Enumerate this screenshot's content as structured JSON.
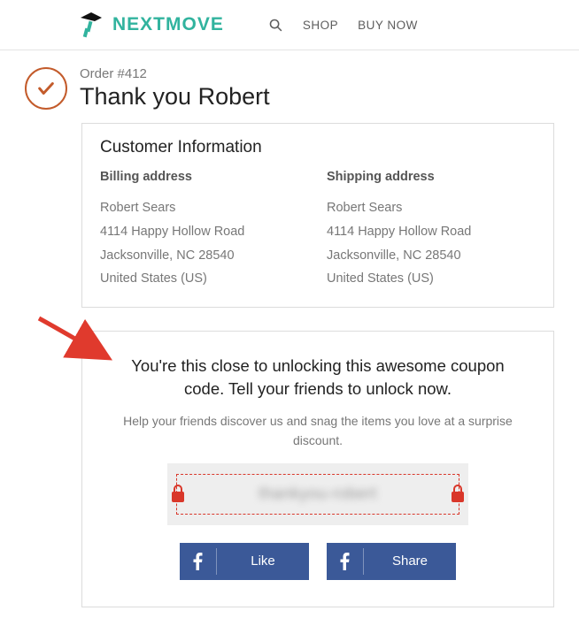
{
  "brand": {
    "name": "NEXTMOVE"
  },
  "nav": {
    "shop": "SHOP",
    "buy_now": "BUY NOW"
  },
  "order": {
    "id_line": "Order #412",
    "thankyou": "Thank you Robert"
  },
  "customer_info": {
    "title": "Customer Information",
    "billing": {
      "label": "Billing address",
      "name": "Robert Sears",
      "street": "4114 Happy Hollow Road",
      "city": "Jacksonville, NC 28540",
      "country": "United States (US)"
    },
    "shipping": {
      "label": "Shipping address",
      "name": "Robert Sears",
      "street": "4114 Happy Hollow Road",
      "city": "Jacksonville, NC 28540",
      "country": "United States (US)"
    }
  },
  "coupon": {
    "headline": "You're this close to unlocking this awesome coupon code. Tell your friends to unlock now.",
    "subtext": "Help your friends discover us and snag the items you love at a surprise discount.",
    "code_hidden": "thankyou-robert",
    "like_label": "Like",
    "share_label": "Share"
  }
}
